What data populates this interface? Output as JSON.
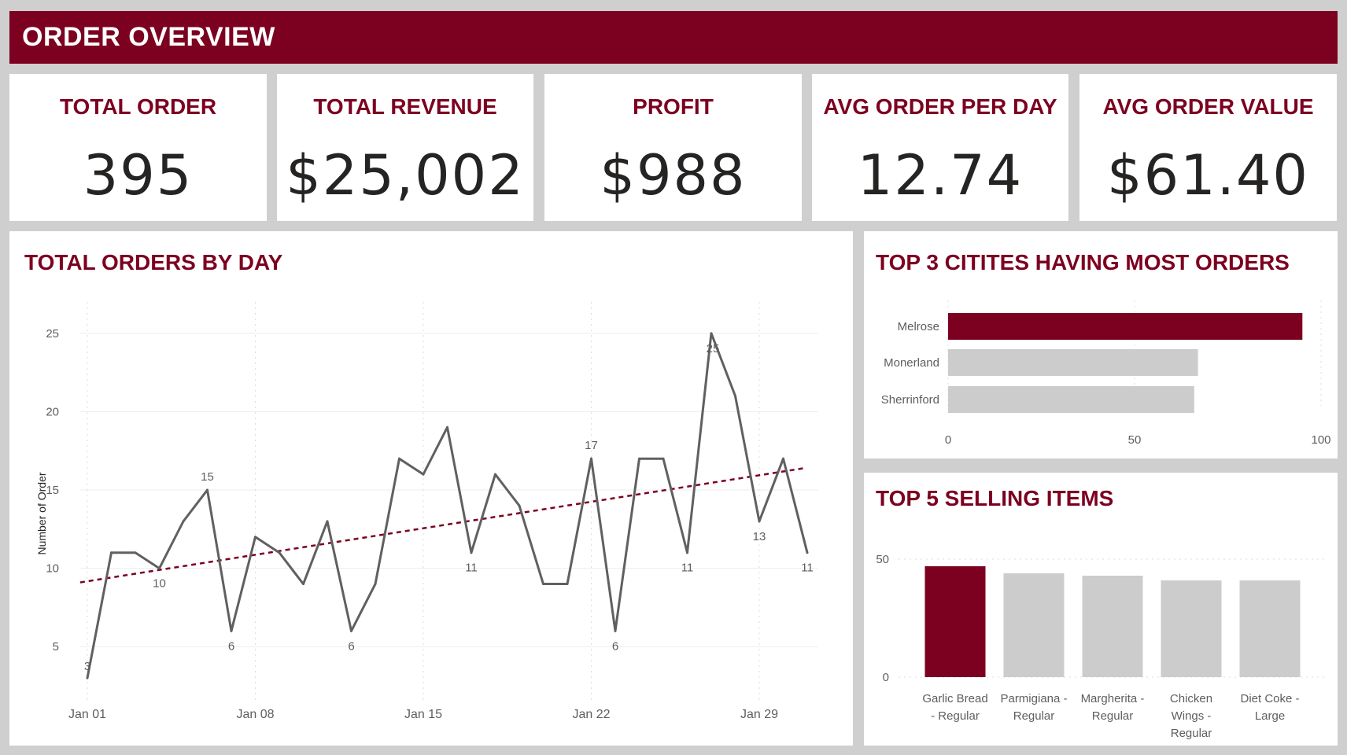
{
  "header": {
    "title": "ORDER OVERVIEW"
  },
  "kpis": [
    {
      "label": "TOTAL ORDER",
      "value": "395"
    },
    {
      "label": "TOTAL REVENUE",
      "value": "$25,002"
    },
    {
      "label": "PROFIT",
      "value": "$988"
    },
    {
      "label": "AVG ORDER PER DAY",
      "value": "12.74"
    },
    {
      "label": "AVG ORDER VALUE",
      "value": "$61.40"
    }
  ],
  "colors": {
    "accent": "#7c0020",
    "bar_gray": "#cccccc",
    "line": "#606060"
  },
  "line_panel": {
    "title": "TOTAL ORDERS BY DAY"
  },
  "cities_panel": {
    "title": "TOP 3 CITITES HAVING MOST ORDERS"
  },
  "items_panel": {
    "title": "TOP 5 SELLING ITEMS"
  },
  "chart_data": [
    {
      "type": "line",
      "title": "TOTAL ORDERS BY DAY",
      "xlabel": "",
      "ylabel": "Number of Order",
      "x": [
        "2024-01-01",
        "2024-01-02",
        "2024-01-03",
        "2024-01-04",
        "2024-01-05",
        "2024-01-06",
        "2024-01-07",
        "2024-01-08",
        "2024-01-09",
        "2024-01-10",
        "2024-01-11",
        "2024-01-12",
        "2024-01-13",
        "2024-01-14",
        "2024-01-15",
        "2024-01-16",
        "2024-01-17",
        "2024-01-18",
        "2024-01-19",
        "2024-01-20",
        "2024-01-21",
        "2024-01-22",
        "2024-01-23",
        "2024-01-24",
        "2024-01-25",
        "2024-01-26",
        "2024-01-27",
        "2024-01-28",
        "2024-01-29",
        "2024-01-30",
        "2024-01-31"
      ],
      "xticks": [
        "Jan 01",
        "Jan 08",
        "Jan 15",
        "Jan 22",
        "Jan 29"
      ],
      "yticks": [
        5,
        10,
        15,
        20,
        25
      ],
      "ylim": [
        2,
        27
      ],
      "series": [
        {
          "values": [
            3,
            11,
            11,
            10,
            13,
            15,
            6,
            12,
            11,
            9,
            13,
            6,
            9,
            17,
            16,
            19,
            11,
            16,
            14,
            9,
            9,
            17,
            6,
            17,
            17,
            11,
            25,
            21,
            13,
            17,
            11
          ],
          "data_labels": [
            {
              "index": 0,
              "text": "3"
            },
            {
              "index": 3,
              "text": "10"
            },
            {
              "index": 5,
              "text": "15"
            },
            {
              "index": 6,
              "text": "6"
            },
            {
              "index": 11,
              "text": "6"
            },
            {
              "index": 16,
              "text": "11"
            },
            {
              "index": 21,
              "text": "17"
            },
            {
              "index": 22,
              "text": "6"
            },
            {
              "index": 25,
              "text": "11"
            },
            {
              "index": 26,
              "text": "25"
            },
            {
              "index": 28,
              "text": "13"
            },
            {
              "index": 30,
              "text": "11"
            }
          ]
        }
      ],
      "trend": {
        "start": 9.1,
        "end": 16.4
      },
      "grid": true
    },
    {
      "type": "bar",
      "orientation": "horizontal",
      "title": "TOP 3 CITITES HAVING MOST ORDERS",
      "categories": [
        "Melrose",
        "Monerland",
        "Sherrinford"
      ],
      "values": [
        95,
        67,
        66
      ],
      "xlim": [
        0,
        100
      ],
      "xticks": [
        0,
        50,
        100
      ],
      "highlight_index": 0
    },
    {
      "type": "bar",
      "title": "TOP 5 SELLING ITEMS",
      "categories": [
        [
          "Garlic Bread",
          "- Regular"
        ],
        [
          "Parmigiana -",
          "Regular"
        ],
        [
          "Margherita -",
          "Regular"
        ],
        [
          "Chicken",
          "Wings -",
          "Regular"
        ],
        [
          "Diet Coke -",
          "Large"
        ]
      ],
      "values": [
        47,
        44,
        43,
        41,
        41
      ],
      "ylim": [
        0,
        50
      ],
      "yticks": [
        0,
        50
      ],
      "highlight_index": 0
    }
  ]
}
